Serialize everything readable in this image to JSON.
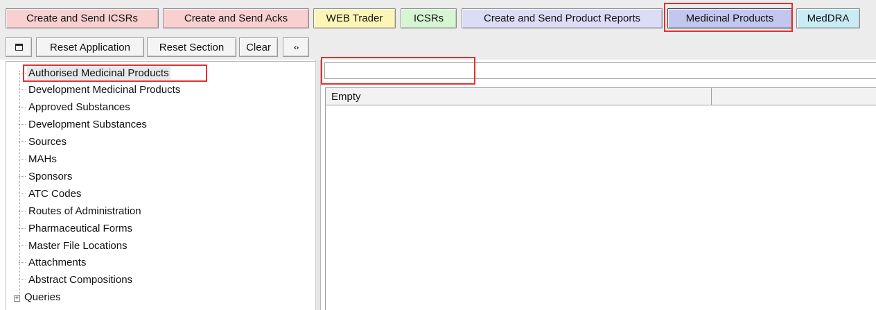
{
  "tabs": [
    {
      "label": "Create and Send ICSRs",
      "color": "#f8d0d0"
    },
    {
      "label": "Create and Send Acks",
      "color": "#f8d0d0"
    },
    {
      "label": "WEB Trader",
      "color": "#fbf6b6"
    },
    {
      "label": "ICSRs",
      "color": "#d6f5d2"
    },
    {
      "label": "Create and Send Product Reports",
      "color": "#dcdcf6"
    },
    {
      "label": "Medicinal Products",
      "color": "#c3c7ef",
      "active": true
    },
    {
      "label": "MedDRA",
      "color": "#c9ecf4"
    }
  ],
  "toolbar": {
    "collapse_icon": "square-icon",
    "reset_application": "Reset Application",
    "reset_section": "Reset Section",
    "clear": "Clear",
    "toggle_icon": "arrows-icon"
  },
  "tree": {
    "items": [
      "Authorised Medicinal Products",
      "Development Medicinal Products",
      "Approved Substances",
      "Development Substances",
      "Sources",
      "MAHs",
      "Sponsors",
      "ATC Codes",
      "Routes of Administration",
      "Pharmaceutical Forms",
      "Master File Locations",
      "Attachments",
      "Abstract Compositions",
      "Queries"
    ],
    "selected_index": 0
  },
  "search": {
    "value": "",
    "placeholder": ""
  },
  "grid": {
    "columns": [
      "Empty",
      ""
    ]
  },
  "highlight_color": "#e23030"
}
